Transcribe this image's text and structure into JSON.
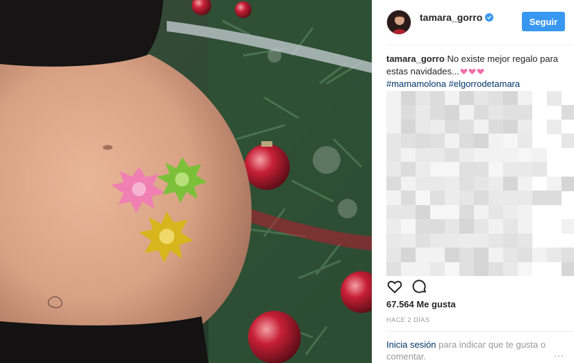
{
  "post": {
    "photo_alt": "",
    "author": {
      "username": "tamara_gorro",
      "verified": true,
      "location": "",
      "follow_label": "Seguir"
    },
    "caption": {
      "username": "tamara_gorro",
      "text": "No existe mejor regalo para estas navidades...",
      "hashtags": [
        "#mamamolona",
        "#elgorrodetamara"
      ]
    },
    "actions": {
      "like_icon": "heart-icon",
      "comment_icon": "comment-icon"
    },
    "likes_text": "67.564 Me gusta",
    "timestamp": "HACE 2 DÍAS",
    "login_prompt": {
      "link": "Inicia sesión",
      "rest": "para indicar que te gusta o comentar.",
      "more_label": "..."
    }
  },
  "colors": {
    "accent": "#3897f0",
    "hashtag": "#003569",
    "secondary_text": "#999999",
    "heart_emoji": "#f06eaa"
  }
}
